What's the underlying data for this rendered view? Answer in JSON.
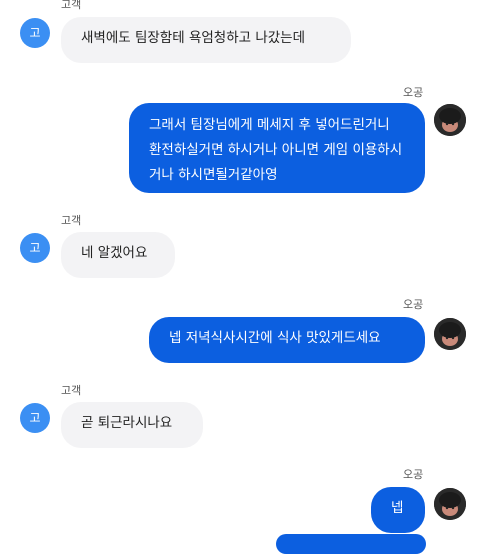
{
  "customer_name": "고객",
  "agent_name": "오공",
  "customer_avatar_letter": "고",
  "colors": {
    "customer_avatar": "#3b8ff3",
    "incoming_bubble": "#f3f3f5",
    "outgoing_bubble": "#0c5fe0"
  },
  "messages": [
    {
      "sender": "customer",
      "text": "새벽에도 팀장함테 욕엄청하고 나갔는데"
    },
    {
      "sender": "agent",
      "text": "그래서 팀장님에게 메세지 후 넣어드린거니 환전하실거면 하시거나 아니면 게임 이용하시거나 하시면될거같아영"
    },
    {
      "sender": "customer",
      "text": "네 알겠어요"
    },
    {
      "sender": "agent",
      "text": "넵 저녁식사시간에 식사 맛있게드세요"
    },
    {
      "sender": "customer",
      "text": "곧 퇴근라시나요"
    },
    {
      "sender": "agent",
      "text": "넵"
    }
  ]
}
